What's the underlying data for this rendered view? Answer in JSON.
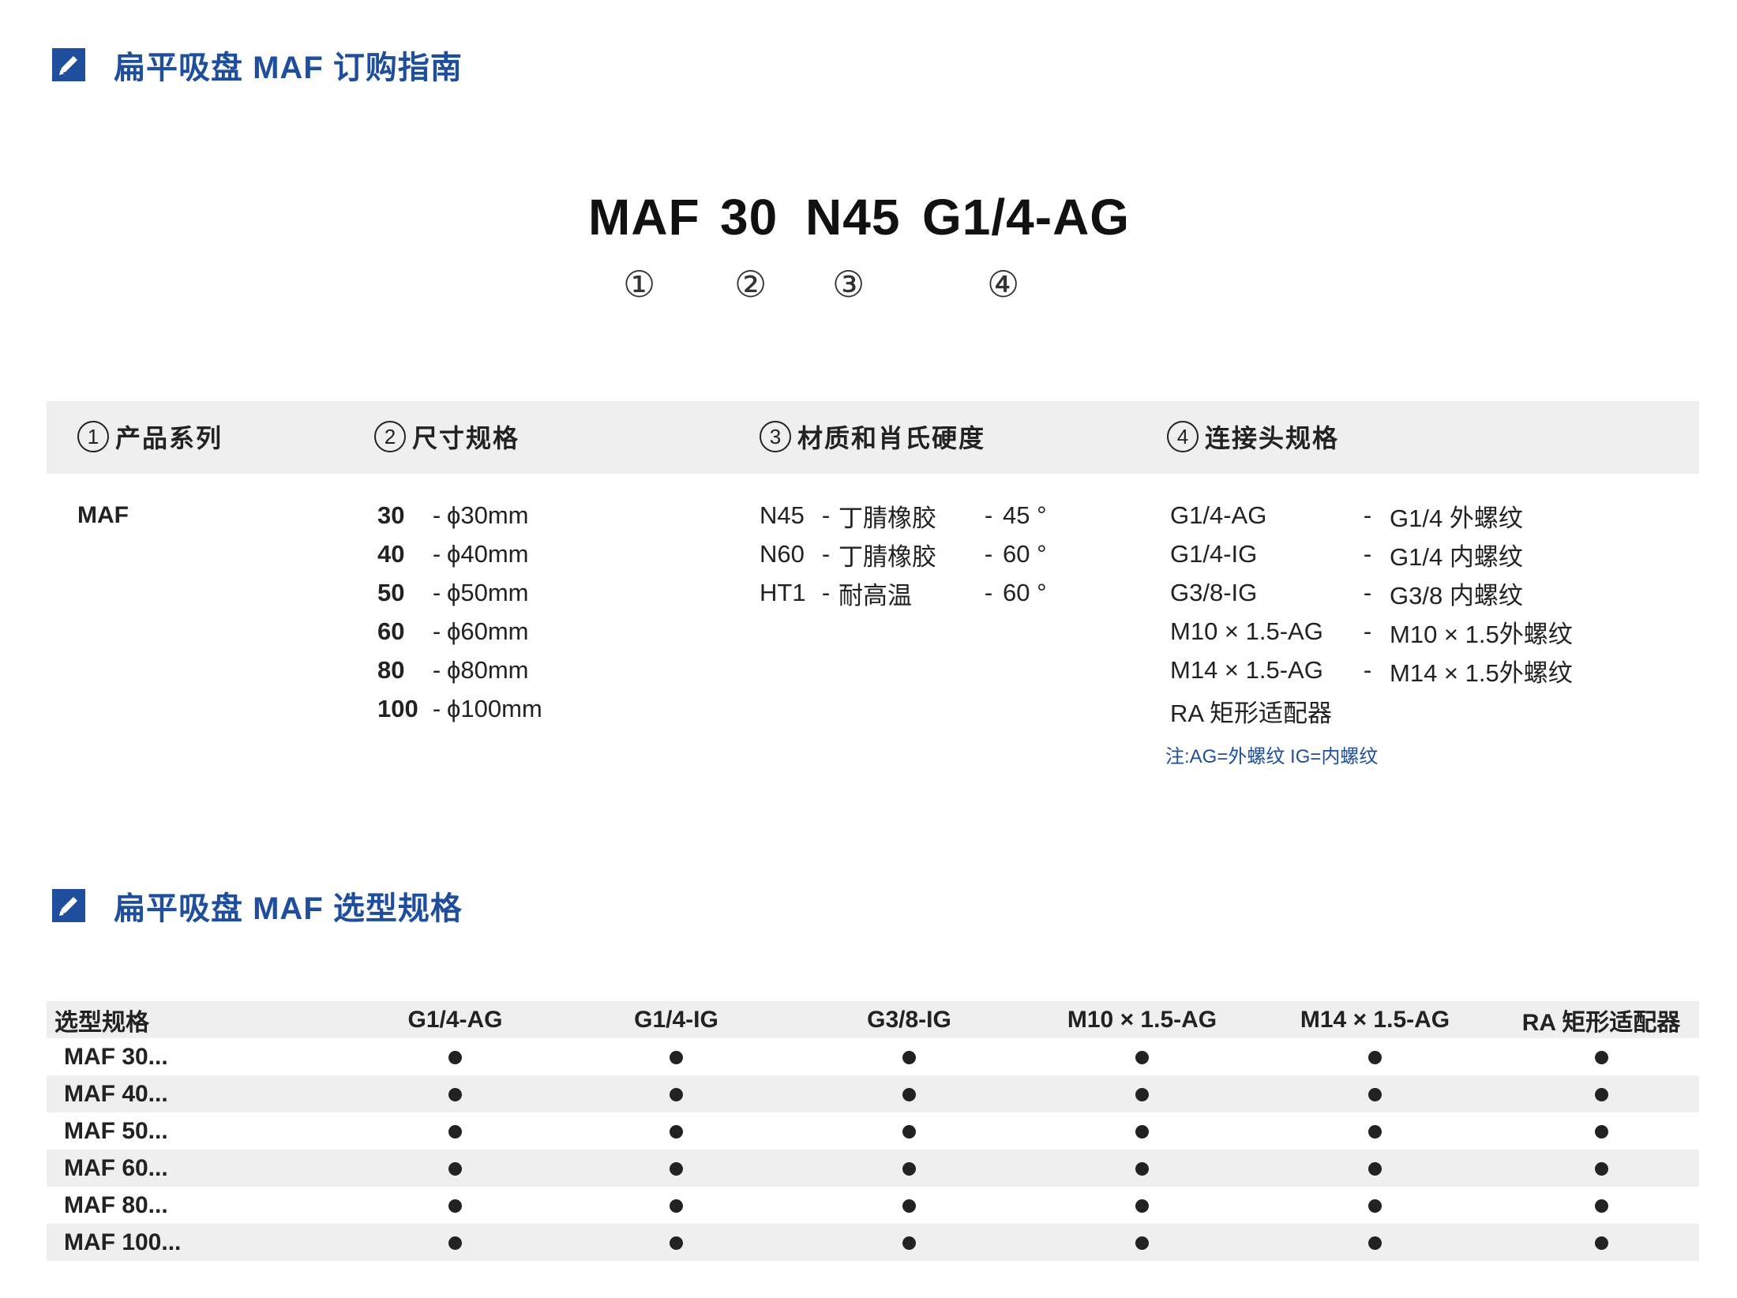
{
  "section1": {
    "title": "扁平吸盘 MAF 订购指南"
  },
  "code": {
    "parts": [
      "MAF",
      "30",
      "N45",
      "G1/4-AG"
    ],
    "markers": [
      "①",
      "②",
      "③",
      "④"
    ]
  },
  "ordering": {
    "headers": [
      {
        "num": "1",
        "label": "产品系列"
      },
      {
        "num": "2",
        "label": "尺寸规格"
      },
      {
        "num": "3",
        "label": "材质和肖氏硬度"
      },
      {
        "num": "4",
        "label": "连接头规格"
      }
    ],
    "series": "MAF",
    "sizes": [
      {
        "code": "30",
        "desc": "ϕ30mm"
      },
      {
        "code": "40",
        "desc": "ϕ40mm"
      },
      {
        "code": "50",
        "desc": "ϕ50mm"
      },
      {
        "code": "60",
        "desc": "ϕ60mm"
      },
      {
        "code": "80",
        "desc": "ϕ80mm"
      },
      {
        "code": "100",
        "desc": "ϕ100mm"
      }
    ],
    "dash": "-",
    "materials": [
      {
        "code": "N45",
        "name": "丁腈橡胶",
        "hardness": "45 °"
      },
      {
        "code": "N60",
        "name": "丁腈橡胶",
        "hardness": "60 °"
      },
      {
        "code": "HT1",
        "name": "耐高温",
        "hardness": "60 °"
      }
    ],
    "connections": [
      {
        "code": "G1/4-AG",
        "desc": "G1/4 外螺纹"
      },
      {
        "code": "G1/4-IG",
        "desc": "G1/4 内螺纹"
      },
      {
        "code": "G3/8-IG",
        "desc": "G3/8 内螺纹"
      },
      {
        "code": "M10 × 1.5-AG",
        "desc": "M10 × 1.5外螺纹"
      },
      {
        "code": "M14 × 1.5-AG",
        "desc": "M14 × 1.5外螺纹"
      }
    ],
    "adapter": "RA 矩形适配器",
    "note": "注:AG=外螺纹    IG=内螺纹"
  },
  "section2": {
    "title": "扁平吸盘 MAF 选型规格"
  },
  "selection": {
    "header_label": "选型规格",
    "columns": [
      "G1/4-AG",
      "G1/4-IG",
      "G3/8-IG",
      "M10 × 1.5-AG",
      "M14 × 1.5-AG",
      "RA 矩形适配器"
    ],
    "rows": [
      "MAF 30...",
      "MAF 40...",
      "MAF 50...",
      "MAF 60...",
      "MAF 80...",
      "MAF 100..."
    ]
  },
  "colors": {
    "accent": "#1f4e9c",
    "band": "#efefef"
  }
}
